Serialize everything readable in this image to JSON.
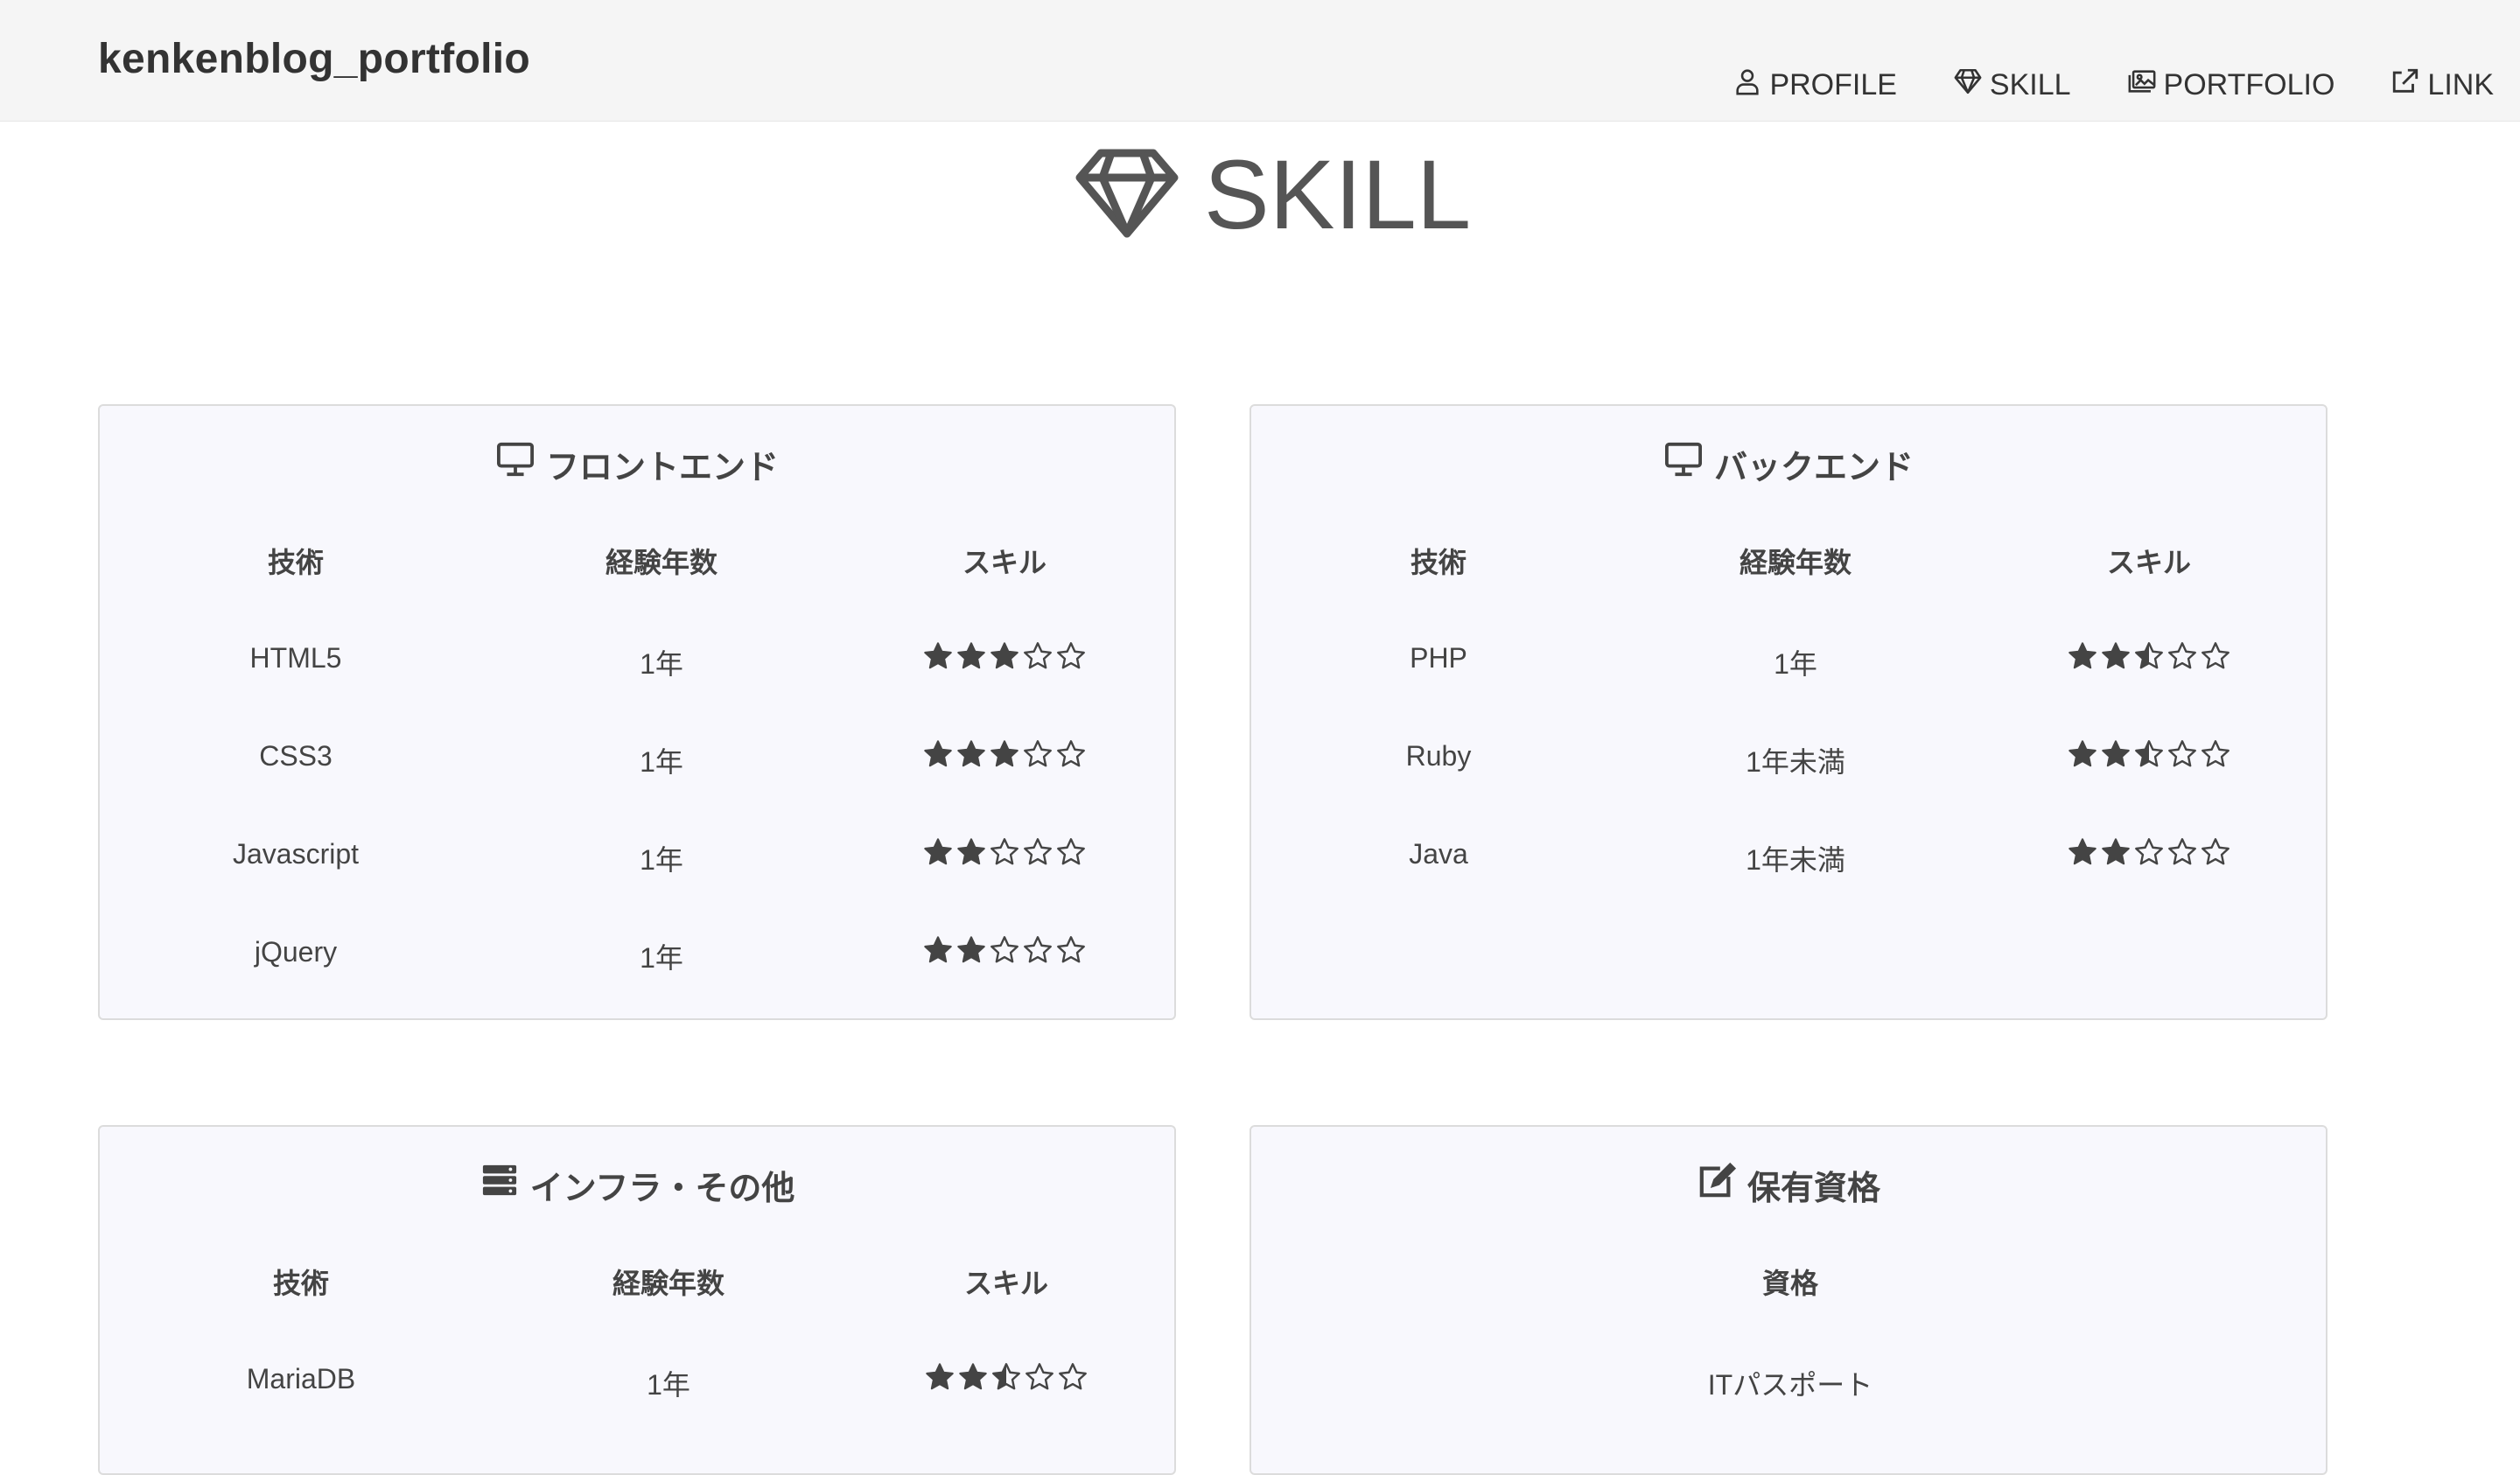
{
  "navbar": {
    "brand": "kenkenblog_portfolio",
    "links": [
      {
        "label": "PROFILE",
        "icon": "user-icon"
      },
      {
        "label": "SKILL",
        "icon": "gem-icon"
      },
      {
        "label": "PORTFOLIO",
        "icon": "images-icon"
      },
      {
        "label": "LINK",
        "icon": "external-link-icon"
      }
    ]
  },
  "page": {
    "title": "SKILL",
    "title_icon": "gem-icon"
  },
  "columns": {
    "tech": "技術",
    "years": "経験年数",
    "skill": "スキル",
    "cert": "資格"
  },
  "cards": {
    "frontend": {
      "title": "フロントエンド",
      "icon": "desktop-icon",
      "rows": [
        {
          "tech": "HTML5",
          "years": "1年",
          "rating": 3
        },
        {
          "tech": "CSS3",
          "years": "1年",
          "rating": 3
        },
        {
          "tech": "Javascript",
          "years": "1年",
          "rating": 2
        },
        {
          "tech": "jQuery",
          "years": "1年",
          "rating": 2
        }
      ]
    },
    "backend": {
      "title": "バックエンド",
      "icon": "desktop-icon",
      "rows": [
        {
          "tech": "PHP",
          "years": "1年",
          "rating": 2.5
        },
        {
          "tech": "Ruby",
          "years": "1年未満",
          "rating": 2.5
        },
        {
          "tech": "Java",
          "years": "1年未満",
          "rating": 2
        }
      ]
    },
    "infra": {
      "title": "インフラ・その他",
      "icon": "server-icon",
      "rows": [
        {
          "tech": "MariaDB",
          "years": "1年",
          "rating": 2.5
        }
      ]
    },
    "certs": {
      "title": "保有資格",
      "icon": "edit-icon",
      "rows": [
        {
          "cert": "ITパスポート"
        }
      ]
    }
  },
  "colors": {
    "navbar_bg": "#f5f5f5",
    "card_bg": "#f8f8fd",
    "text": "#444444",
    "star": "#444444"
  }
}
